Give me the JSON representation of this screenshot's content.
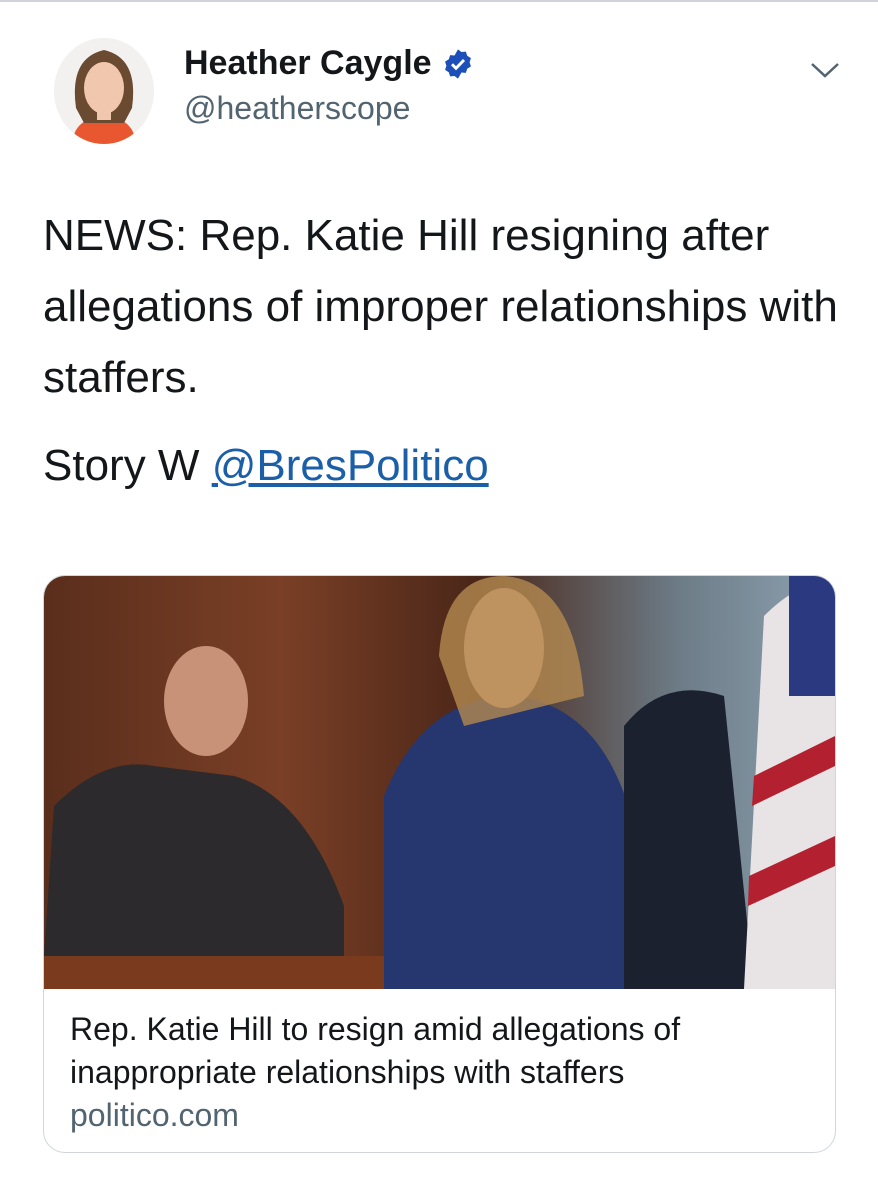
{
  "author": {
    "name": "Heather Caygle",
    "handle": "@heatherscope",
    "verified": true
  },
  "tweet": {
    "text": "NEWS: Rep. Katie Hill resigning after allegations of improper relationships with staffers.",
    "story_prefix": "Story W ",
    "mention": "@BresPolitico"
  },
  "card": {
    "title": "Rep. Katie Hill to resign amid allegations of inappropriate relationships with staffers",
    "domain": "politico.com"
  },
  "icons": {
    "verified": "verified-badge-icon",
    "menu": "chevron-down-icon"
  },
  "colors": {
    "link": "#1b5fa8",
    "verified": "#1d4fb8"
  }
}
